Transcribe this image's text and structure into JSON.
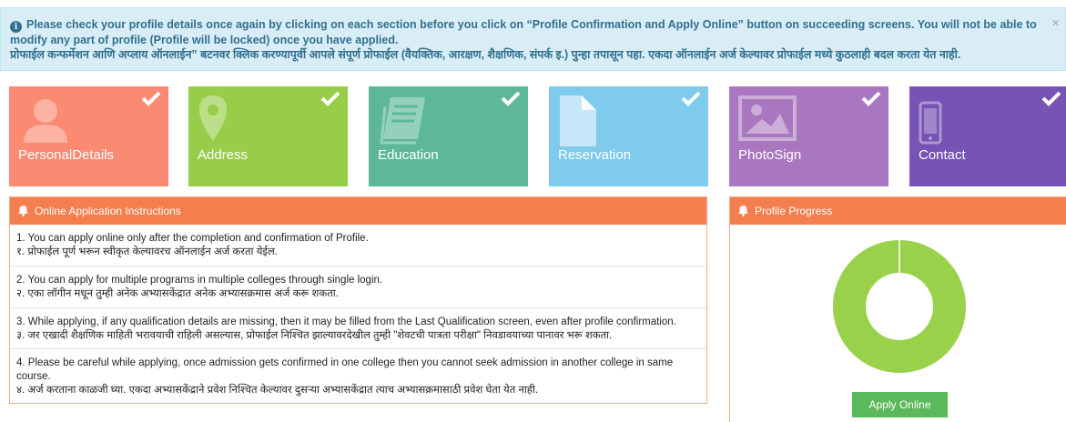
{
  "alert": {
    "line1": "Please check your profile details once again by clicking on each section before you click on “Profile Confirmation and Apply Online” button on succeeding screens. You will not be able to modify any part of profile (Profile will be locked) once you have applied.",
    "line2": "प्रोफाईल कन्फर्मेशन आणि अप्लाय ऑनलाईन” बटनवर क्लिक करण्यापूर्वी आपले संपूर्ण प्रोफाईल (वैयक्तिक, आरक्षण, शैक्षणिक, संपर्क इ.) पुन्हा तपासून पहा. एकदा ऑनलाईन अर्ज केल्यावर प्रोफाईल मध्ये कुठलाही बदल करता येत नाही.",
    "close": "×"
  },
  "tiles": [
    {
      "label": "PersonalDetails",
      "color": "#fa8a72",
      "icon": "user-icon"
    },
    {
      "label": "Address",
      "color": "#98cd4a",
      "icon": "map-marker-icon"
    },
    {
      "label": "Education",
      "color": "#5cb896",
      "icon": "book-icon"
    },
    {
      "label": "Reservation",
      "color": "#7fcbee",
      "icon": "document-icon"
    },
    {
      "label": "PhotoSign",
      "color": "#a977bf",
      "icon": "image-icon"
    },
    {
      "label": "Contact",
      "color": "#7653b4",
      "icon": "mobile-icon"
    }
  ],
  "instructions": {
    "title": "Online Application Instructions",
    "items": [
      {
        "en": "1. You can apply online only after the completion and confirmation of Profile.",
        "mr": "१. प्रोफाईल पूर्ण भरून स्वीकृत केल्यावरच ऑनलाईन अर्ज करता येईल."
      },
      {
        "en": "2. You can apply for multiple programs in multiple colleges through single login.",
        "mr": "२. एका लॉगीन मधून तुम्ही अनेक अभ्यासकेंद्रात अनेक अभ्यासक्रमास अर्ज करू शकता."
      },
      {
        "en": "3. While applying, if any qualification details are missing, then it may be filled from the Last Qualification screen, even after profile confirmation.",
        "mr": "३. जर एखादी शैक्षणिक माहिती भरावयाची राहिली असल्यास, प्रोफाईल निश्चित झाल्यावरदेखील तुम्ही \"शेवटची पात्रता परीक्षा\" निवडावयाच्या पानावर भरू शकता."
      },
      {
        "en": "4. Please be careful while applying, once admission gets confirmed in one college then you cannot seek admission in another college in same course.",
        "mr": "४. अर्ज करताना काळजी घ्या. एकदा अभ्यासकेंद्राने प्रवेश निश्चित केल्यावर दुसऱ्या अभ्यासकेंद्रात त्याच अभ्यासक्रमासाठी प्रवेश घेता येत नाही."
      }
    ]
  },
  "progress": {
    "title": "Profile Progress",
    "percent": 100,
    "color": "#9ad14b",
    "apply_label": "Apply Online"
  }
}
